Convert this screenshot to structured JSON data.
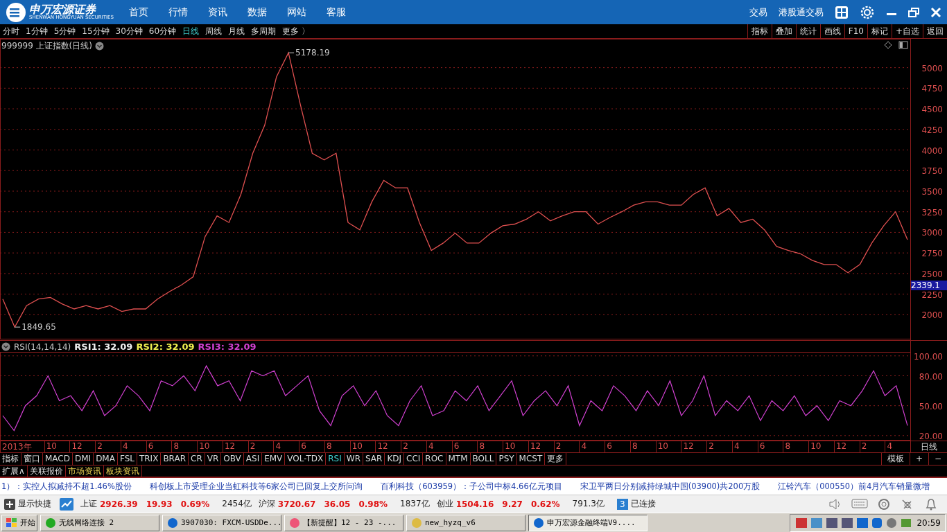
{
  "app_bar": {
    "brand": "申万宏源证券",
    "brand_sub": "SHENWAN HONGYUAN SECURITIES",
    "nav": [
      "首页",
      "行情",
      "资讯",
      "数据",
      "网站",
      "客服"
    ],
    "links": [
      "交易",
      "港股通交易"
    ]
  },
  "periods": [
    {
      "label": "分时",
      "selected": false
    },
    {
      "label": "1分钟",
      "selected": false
    },
    {
      "label": "5分钟",
      "selected": false
    },
    {
      "label": "15分钟",
      "selected": false
    },
    {
      "label": "30分钟",
      "selected": false
    },
    {
      "label": "60分钟",
      "selected": false
    },
    {
      "label": "日线",
      "selected": true
    },
    {
      "label": "周线",
      "selected": false
    },
    {
      "label": "月线",
      "selected": false
    },
    {
      "label": "多周期",
      "selected": false
    },
    {
      "label": "更多 〉",
      "selected": false
    }
  ],
  "tools": [
    "指标",
    "叠加",
    "统计",
    "画线",
    "F10",
    "标记",
    "+自选",
    "返回"
  ],
  "price_pane": {
    "title": "999999 上证指数(日线)",
    "cursor_label": "2339.1",
    "chart_data": {
      "type": "line",
      "grid": true,
      "series": [
        {
          "color": "#e05050",
          "values": [
            2190,
            1850,
            2110,
            2190,
            2210,
            2130,
            2070,
            2110,
            2070,
            2110,
            2040,
            2070,
            2070,
            2190,
            2280,
            2360,
            2460,
            2950,
            3200,
            3120,
            3460,
            3960,
            4300,
            4890,
            5180,
            4550,
            3960,
            3880,
            3960,
            3120,
            3030,
            3370,
            3630,
            3540,
            3540,
            3120,
            2780,
            2870,
            2990,
            2870,
            2870,
            2990,
            3080,
            3100,
            3160,
            3250,
            3140,
            3200,
            3250,
            3250,
            3100,
            3180,
            3250,
            3330,
            3370,
            3370,
            3330,
            3330,
            3460,
            3540,
            3200,
            3290,
            3120,
            3160,
            3030,
            2830,
            2780,
            2740,
            2660,
            2610,
            2610,
            2510,
            2610,
            2870,
            3080,
            3250,
            2910
          ]
        }
      ],
      "ylim": [
        1700,
        5350
      ],
      "yticks": [
        2000,
        2250,
        2500,
        2750,
        3000,
        3250,
        3500,
        3750,
        4000,
        4250,
        4500,
        4750,
        5000
      ],
      "annotations": [
        "5178.19",
        "1849.65"
      ]
    }
  },
  "rsi_pane": {
    "title": "RSI(14,14,14)",
    "legend": [
      {
        "label": "RSI1: 32.09",
        "color": "#f0f0f0"
      },
      {
        "label": "RSI2: 32.09",
        "color": "#f0f050"
      },
      {
        "label": "RSI3: 32.09",
        "color": "#d040d0"
      }
    ],
    "chart_data": {
      "type": "line",
      "grid": true,
      "series": [
        {
          "color": "#d040d0",
          "values": [
            40,
            25,
            50,
            60,
            80,
            55,
            60,
            45,
            65,
            40,
            50,
            70,
            60,
            45,
            75,
            70,
            80,
            65,
            90,
            70,
            75,
            55,
            85,
            80,
            85,
            60,
            70,
            80,
            45,
            30,
            60,
            70,
            50,
            65,
            40,
            30,
            55,
            70,
            40,
            45,
            65,
            55,
            70,
            45,
            60,
            75,
            40,
            55,
            65,
            50,
            70,
            30,
            55,
            45,
            70,
            60,
            45,
            65,
            50,
            75,
            40,
            55,
            80,
            40,
            55,
            45,
            60,
            35,
            55,
            45,
            60,
            40,
            50,
            35,
            55,
            50,
            65,
            85,
            60,
            70,
            30
          ]
        }
      ],
      "ylim": [
        15,
        104
      ],
      "yticks": [
        {
          "value": 20,
          "label": "20.00"
        },
        {
          "value": 50,
          "label": "50.00"
        },
        {
          "value": 80,
          "label": "80.00"
        },
        {
          "value": 100,
          "label": "100.00"
        }
      ]
    }
  },
  "date_axis": {
    "labels": [
      "2013年",
      "10",
      "12",
      "2",
      "4",
      "6",
      "8",
      "10",
      "12",
      "2",
      "4",
      "6",
      "8",
      "10",
      "12",
      "2",
      "4",
      "6",
      "8",
      "10",
      "12",
      "2",
      "4",
      "6",
      "8",
      "10",
      "12",
      "2",
      "4",
      "6",
      "8",
      "10",
      "12",
      "2",
      "4"
    ],
    "period": "日线"
  },
  "indicators": [
    {
      "label": "指标",
      "selected": false
    },
    {
      "label": "窗口",
      "selected": false
    },
    {
      "label": "MACD",
      "selected": false
    },
    {
      "label": "DMI",
      "selected": false
    },
    {
      "label": "DMA",
      "selected": false
    },
    {
      "label": "FSL",
      "selected": false
    },
    {
      "label": "TRIX",
      "selected": false
    },
    {
      "label": "BRAR",
      "selected": false
    },
    {
      "label": "CR",
      "selected": false
    },
    {
      "label": "VR",
      "selected": false
    },
    {
      "label": "OBV",
      "selected": false
    },
    {
      "label": "ASI",
      "selected": false
    },
    {
      "label": "EMV",
      "selected": false
    },
    {
      "label": "VOL-TDX",
      "selected": false
    },
    {
      "label": "RSI",
      "selected": true
    },
    {
      "label": "WR",
      "selected": false
    },
    {
      "label": "SAR",
      "selected": false
    },
    {
      "label": "KDJ",
      "selected": false
    },
    {
      "label": "CCI",
      "selected": false
    },
    {
      "label": "ROC",
      "selected": false
    },
    {
      "label": "MTM",
      "selected": false
    },
    {
      "label": "BOLL",
      "selected": false
    },
    {
      "label": "PSY",
      "selected": false
    },
    {
      "label": "MCST",
      "selected": false
    },
    {
      "label": "更多",
      "selected": false
    }
  ],
  "indicator_right": [
    "模板",
    "+",
    "−"
  ],
  "info_tabs": [
    {
      "label": "扩展∧",
      "highlighted": false
    },
    {
      "label": "关联报价",
      "highlighted": false
    },
    {
      "label": "市场资讯",
      "highlighted": true
    },
    {
      "label": "板块资讯",
      "highlighted": true
    }
  ],
  "ticker": [
    "1）：实控人拟减持不超1.46%股份",
    "科创板上市受理企业当虹科技等6家公司已回复上交所问询",
    "百利科技（603959）：子公司中标4.66亿元项目",
    "宋卫平两日分别减持绿城中国(03900)共200万股",
    "江铃汽车（000550）前4月汽车销量微增"
  ],
  "status": {
    "shortcut": "显示快捷",
    "indices": [
      {
        "name": "上证",
        "price": "2926.39",
        "change": "19.93",
        "pct": "0.69%",
        "volume": "2454亿"
      },
      {
        "name": "沪深",
        "price": "3720.67",
        "change": "36.05",
        "pct": "0.98%",
        "volume": "1837亿"
      },
      {
        "name": "创业",
        "price": "1504.16",
        "change": "9.27",
        "pct": "0.62%",
        "volume": "791.3亿"
      }
    ],
    "conn_count": "3",
    "conn": "已连接"
  },
  "taskbar": {
    "start": "开始",
    "tasks": [
      {
        "label": "无线网络连接 2",
        "selected": false
      },
      {
        "label": "3907030: FXCM-USDDe...",
        "selected": false
      },
      {
        "label": "【新提醒】12 - 23 -...",
        "selected": false
      },
      {
        "label": "new_hyzq_v6",
        "selected": false
      },
      {
        "label": "申万宏源金融终端V9....",
        "selected": true
      }
    ],
    "clock": "20:59"
  }
}
